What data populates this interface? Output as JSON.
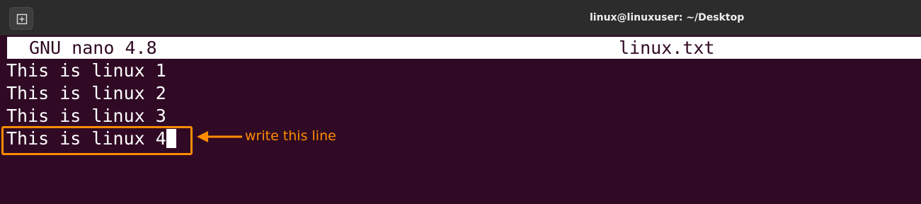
{
  "titlebar": {
    "title": "linux@linuxuser: ~/Desktop",
    "new_tab_icon": "new-tab-icon"
  },
  "nano": {
    "version": "GNU nano 4.8",
    "filename": "linux.txt"
  },
  "editor": {
    "lines": [
      "This is linux 1",
      "This is linux 2",
      "This is linux 3",
      "This is linux 4"
    ]
  },
  "annotation": {
    "text": "write this line",
    "color": "#ff8c00"
  },
  "colors": {
    "terminal_bg": "#300a24",
    "titlebar_bg": "#2c2c2c",
    "text": "#ffffff"
  }
}
